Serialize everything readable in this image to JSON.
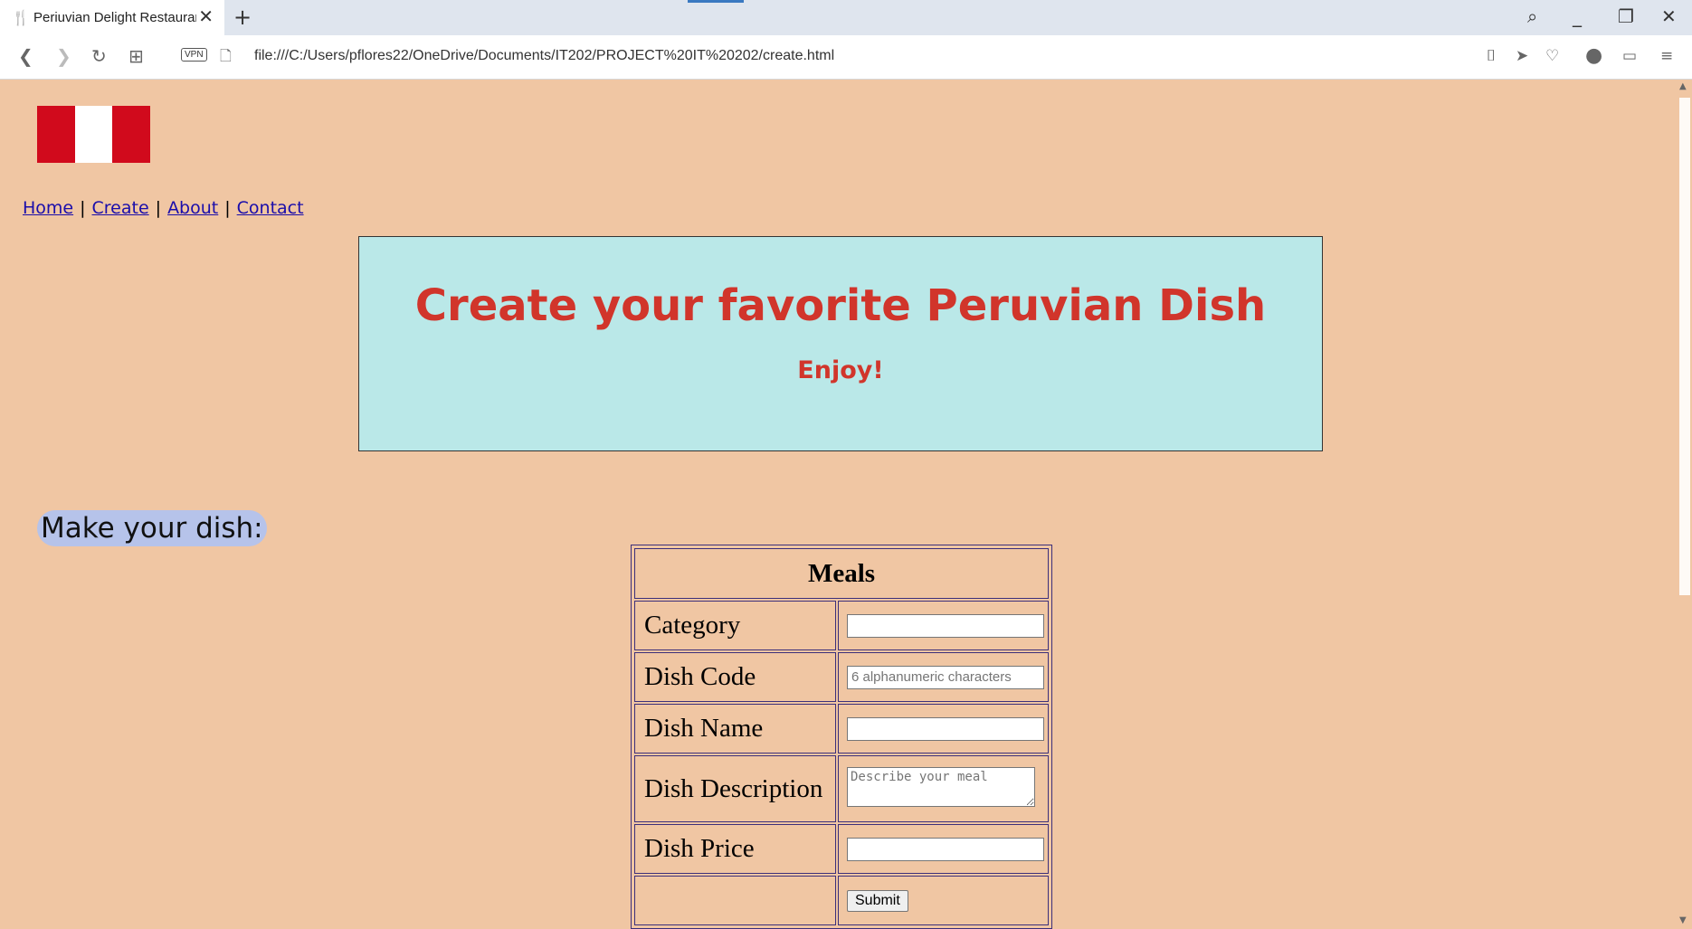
{
  "browser": {
    "tab_title": "Periuvian Delight Restaurant",
    "url": "file:///C:/Users/pflores22/OneDrive/Documents/IT202/PROJECT%20IT%20202/create.html",
    "vpn_label": "VPN"
  },
  "nav": {
    "links": [
      "Home",
      "Create",
      "About",
      "Contact"
    ],
    "separator": "|"
  },
  "hero": {
    "title": "Create your favorite Peruvian Dish",
    "subtitle": "Enjoy!"
  },
  "form": {
    "heading": "Make your dish:",
    "table_title": "Meals",
    "fields": {
      "category": {
        "label": "Category",
        "value": "",
        "placeholder": ""
      },
      "dish_code": {
        "label": "Dish Code",
        "value": "",
        "placeholder": "6 alphanumeric characters"
      },
      "dish_name": {
        "label": "Dish Name",
        "value": "",
        "placeholder": ""
      },
      "dish_description": {
        "label": "Dish Description",
        "value": "",
        "placeholder": "Describe your meal"
      },
      "dish_price": {
        "label": "Dish Price",
        "value": "",
        "placeholder": ""
      }
    },
    "submit_label": "Submit"
  },
  "colors": {
    "page_background": "#f0c6a3",
    "hero_background": "#bae8e8",
    "hero_text": "#d1352b",
    "flag_red": "#d10a1c",
    "heading_highlight": "#b6c3ea"
  }
}
